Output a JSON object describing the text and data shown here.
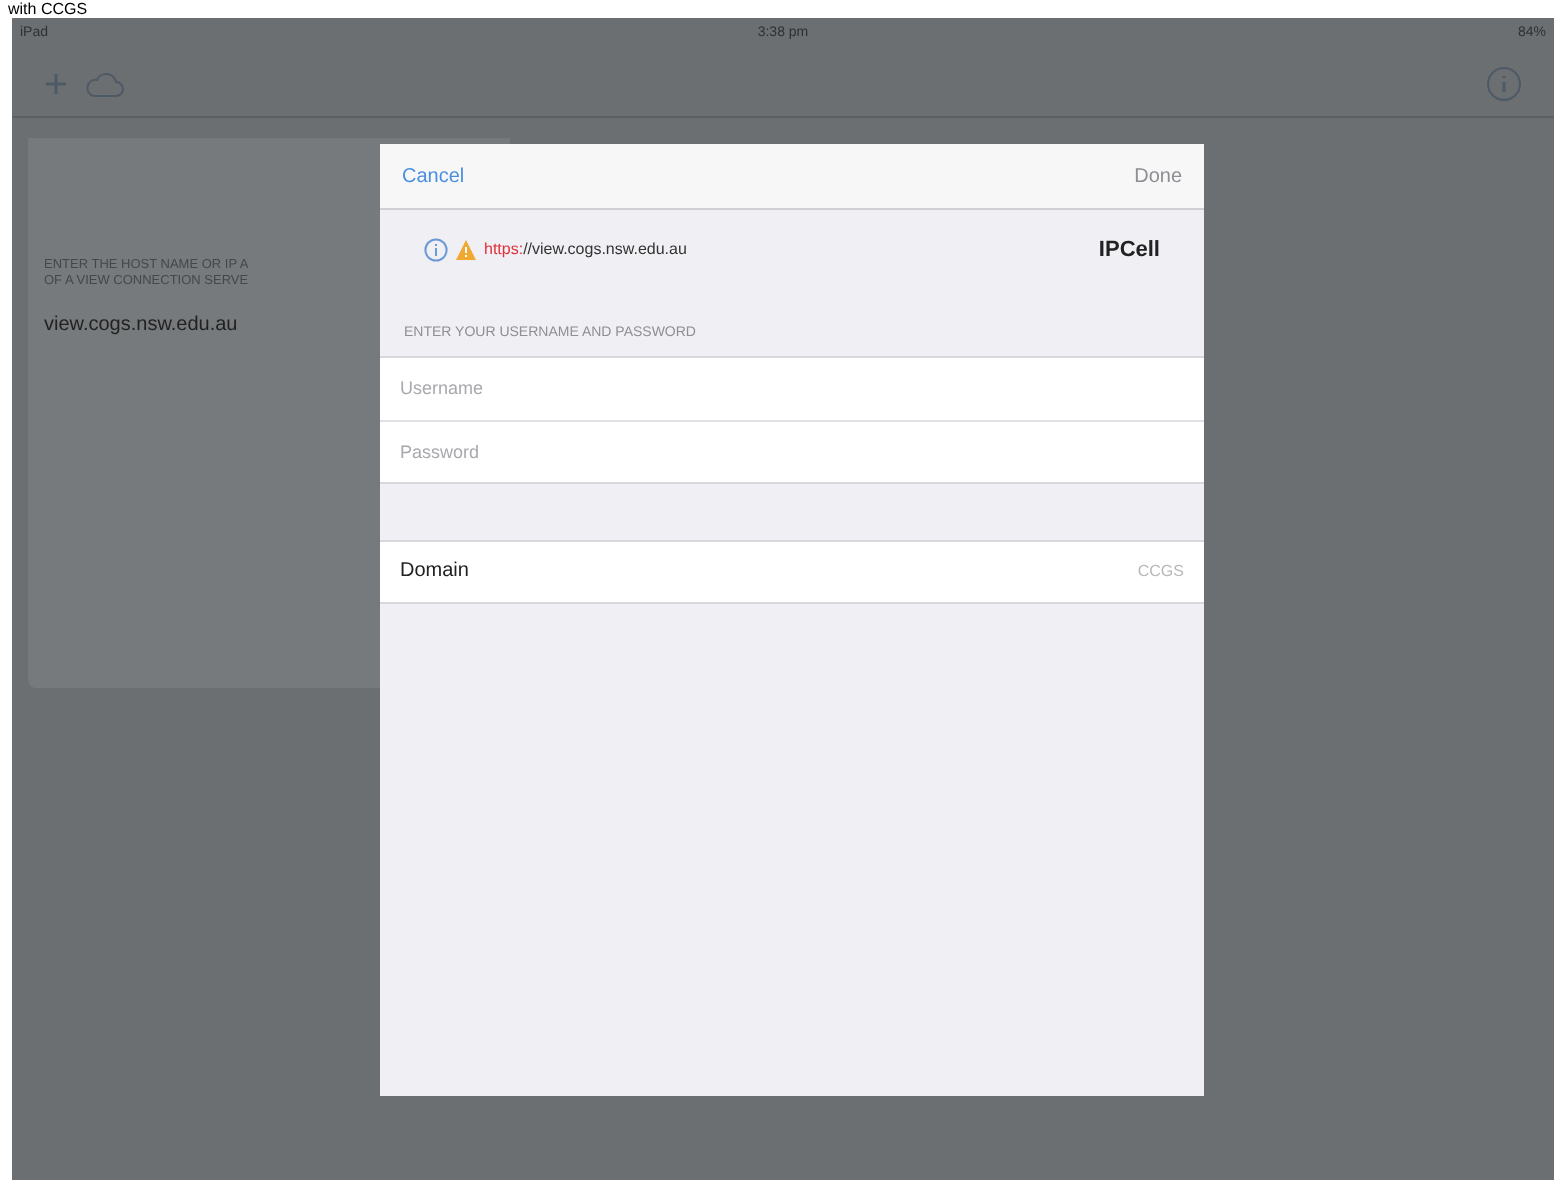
{
  "page_heading": "with CCGS",
  "status_bar": {
    "carrier": "iPad",
    "time": "3:38 pm",
    "battery": "84%"
  },
  "background_panel": {
    "hint_lines": [
      "ENTER THE HOST NAME OR IP A",
      "OF A VIEW CONNECTION SERVE"
    ],
    "server": "view.cogs.nsw.edu.au"
  },
  "dialog": {
    "cancel": "Cancel",
    "done": {
      "label": "Done",
      "disabled": true
    },
    "url": {
      "scheme": "https:",
      "rest": "//view.cogs.nsw.edu.au",
      "insecure": true
    },
    "logo": "IPCell",
    "section_header": "ENTER YOUR USERNAME AND PASSWORD",
    "fields": [
      {
        "placeholder": "Username"
      },
      {
        "placeholder": "Password"
      }
    ],
    "domain": {
      "label": "Domain",
      "value": "CCGS"
    }
  }
}
